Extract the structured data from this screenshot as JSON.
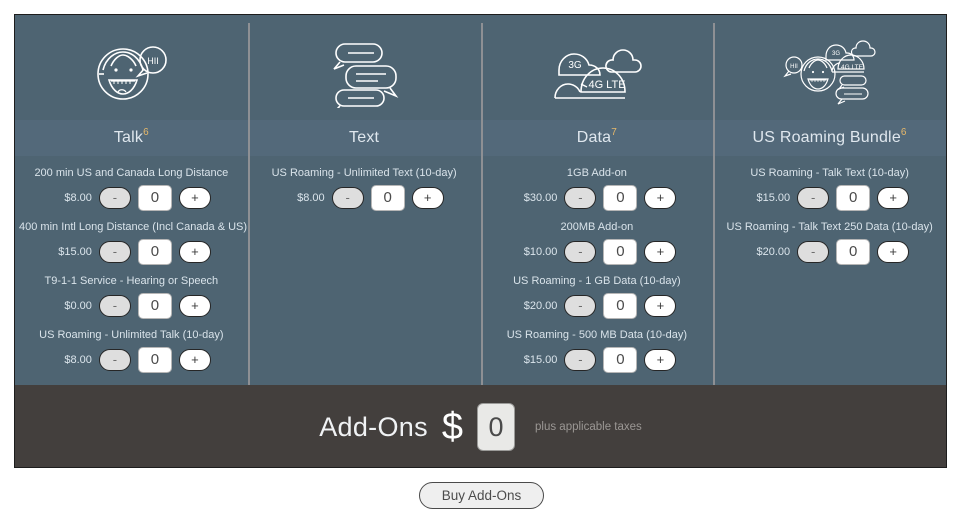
{
  "panel": {
    "columns": [
      {
        "id": "talk",
        "title": "Talk",
        "superscript": "6",
        "icon": "talk-face-speech-bubble-icon",
        "addons": [
          {
            "label": "200 min US and Canada Long Distance",
            "price": "$8.00",
            "qty": "0",
            "minus": "-",
            "plus": "+"
          },
          {
            "label": "400 min Intl Long Distance (Incl Canada & US)",
            "price": "$15.00",
            "qty": "0",
            "minus": "-",
            "plus": "+"
          },
          {
            "label": "T9-1-1 Service - Hearing or Speech",
            "price": "$0.00",
            "qty": "0",
            "minus": "-",
            "plus": "+"
          },
          {
            "label": "US Roaming - Unlimited Talk (10-day)",
            "price": "$8.00",
            "qty": "0",
            "minus": "-",
            "plus": "+"
          }
        ]
      },
      {
        "id": "text",
        "title": "Text",
        "superscript": "",
        "icon": "chat-bubbles-icon",
        "addons": [
          {
            "label": "US Roaming - Unlimited Text (10-day)",
            "price": "$8.00",
            "qty": "0",
            "minus": "-",
            "plus": "+"
          }
        ]
      },
      {
        "id": "data",
        "title": "Data",
        "superscript": "7",
        "icon": "data-clouds-3g-4glte-icon",
        "addons": [
          {
            "label": "1GB Add-on",
            "price": "$30.00",
            "qty": "0",
            "minus": "-",
            "plus": "+"
          },
          {
            "label": "200MB Add-on",
            "price": "$10.00",
            "qty": "0",
            "minus": "-",
            "plus": "+"
          },
          {
            "label": "US Roaming - 1 GB Data (10-day)",
            "price": "$20.00",
            "qty": "0",
            "minus": "-",
            "plus": "+"
          },
          {
            "label": "US Roaming - 500 MB Data (10-day)",
            "price": "$15.00",
            "qty": "0",
            "minus": "-",
            "plus": "+"
          }
        ]
      },
      {
        "id": "us-roaming-bundle",
        "title": "US Roaming Bundle",
        "superscript": "6",
        "icon": "roaming-bundle-combined-icon",
        "addons": [
          {
            "label": "US Roaming - Talk Text (10-day)",
            "price": "$15.00",
            "qty": "0",
            "minus": "-",
            "plus": "+"
          },
          {
            "label": "US Roaming - Talk Text 250 Data (10-day)",
            "price": "$20.00",
            "qty": "0",
            "minus": "-",
            "plus": "+"
          }
        ]
      }
    ]
  },
  "total": {
    "label": "Add-Ons",
    "currency_symbol": "$",
    "amount": "0",
    "note": "plus applicable taxes"
  },
  "actions": {
    "buy_label": "Buy Add-Ons"
  },
  "icon_labels": {
    "talk_bubble_text": "HII",
    "data_3g": "3G",
    "data_4glte": "4G LTE"
  },
  "colors": {
    "panel_bg": "#4e6472",
    "title_band": "#53697a",
    "total_bar": "#433f3d",
    "divider": "#8e9094",
    "superscript": "#e6b86a"
  }
}
